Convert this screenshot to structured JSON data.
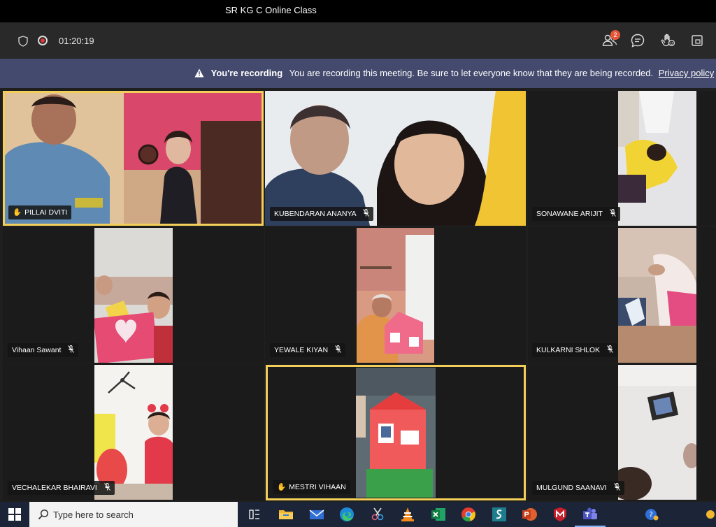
{
  "window": {
    "title": "SR KG C Online Class"
  },
  "controls": {
    "timer": "01:20:19",
    "participants_badge": "2"
  },
  "banner": {
    "heading": "You're recording",
    "message": "You are recording this meeting. Be sure to let everyone know that they are being recorded.",
    "link": "Privacy policy"
  },
  "participants": [
    {
      "name": "PILLAI DVITI",
      "hand_raised": true
    },
    {
      "name": "KUBENDARAN ANANYA",
      "hand_raised": false
    },
    {
      "name": "SONAWANE ARIJIT",
      "hand_raised": false
    },
    {
      "name": "Vihaan Sawant",
      "hand_raised": false
    },
    {
      "name": "YEWALE KIYAN",
      "hand_raised": false
    },
    {
      "name": "KULKARNI SHLOK",
      "hand_raised": false
    },
    {
      "name": "VECHALEKAR BHAIRAVI",
      "hand_raised": false
    },
    {
      "name": "MESTRI VIHAAN",
      "hand_raised": true
    },
    {
      "name": "MULGUND SAANAVI",
      "hand_raised": false
    }
  ],
  "taskbar": {
    "search_placeholder": "Type here to search",
    "apps": [
      "task-view-icon",
      "file-explorer-icon",
      "mail-icon",
      "edge-icon",
      "snipping-tool-icon",
      "vlc-icon",
      "excel-icon",
      "chrome-icon",
      "sway-icon",
      "powerpoint-icon",
      "mcafee-icon",
      "teams-icon"
    ]
  },
  "colors": {
    "active_speaker_border": "#f3cf5a",
    "banner_bg": "#444a6d",
    "record_red": "#e23a3a"
  }
}
